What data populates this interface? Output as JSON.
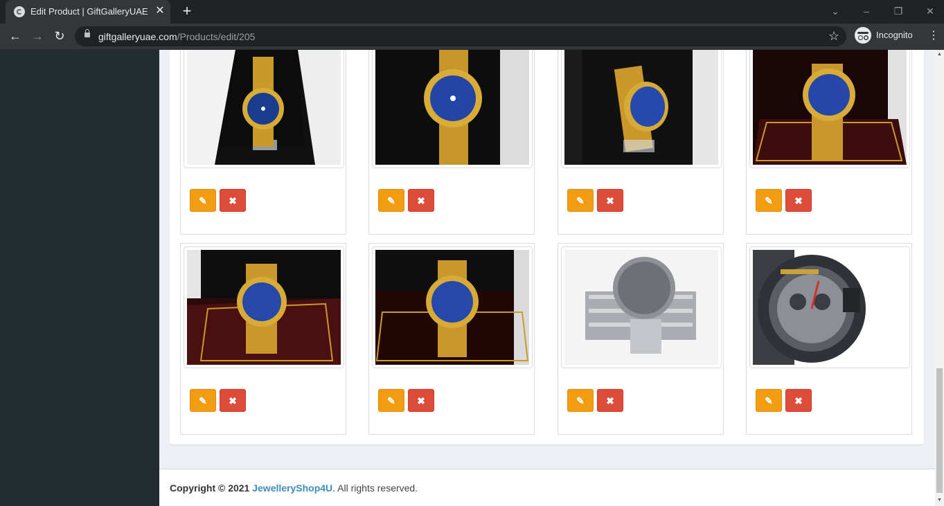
{
  "browser": {
    "tab_title": "Edit Product | GiftGalleryUAE",
    "tab_close": "✕",
    "new_tab": "+",
    "url_host": "giftgalleryuae.com",
    "url_path": "/Products/edit/205",
    "incognito_label": "Incognito",
    "icons": [
      "back-arrow",
      "forward-arrow",
      "reload",
      "lock",
      "star",
      "incognito",
      "menu",
      "tab-search",
      "minimize",
      "restore",
      "close"
    ]
  },
  "product_images": [
    {
      "id": "1",
      "style": "gold-watch-blue-dial-dark-box"
    },
    {
      "id": "2",
      "style": "gold-watch-blue-dial-closeup"
    },
    {
      "id": "3",
      "style": "gold-watch-blue-dial-side"
    },
    {
      "id": "4",
      "style": "gold-watch-blue-dial-red-box"
    },
    {
      "id": "5",
      "style": "gold-watch-blue-dial-red-box-2"
    },
    {
      "id": "6",
      "style": "gold-watch-blue-dial-red-box-3"
    },
    {
      "id": "7",
      "style": "silver-watch-back"
    },
    {
      "id": "8",
      "style": "gunmetal-chronograph"
    }
  ],
  "buttons": {
    "edit_icon": "edit-icon",
    "delete_icon": "delete-icon"
  },
  "colors": {
    "edit": "#f39c12",
    "delete": "#dd4b39",
    "sidebar": "#222d32",
    "link": "#3c8dbc"
  },
  "footer": {
    "copyright": "Copyright © 2021",
    "brand": "JewelleryShop4U",
    "rights": ". All rights reserved."
  }
}
